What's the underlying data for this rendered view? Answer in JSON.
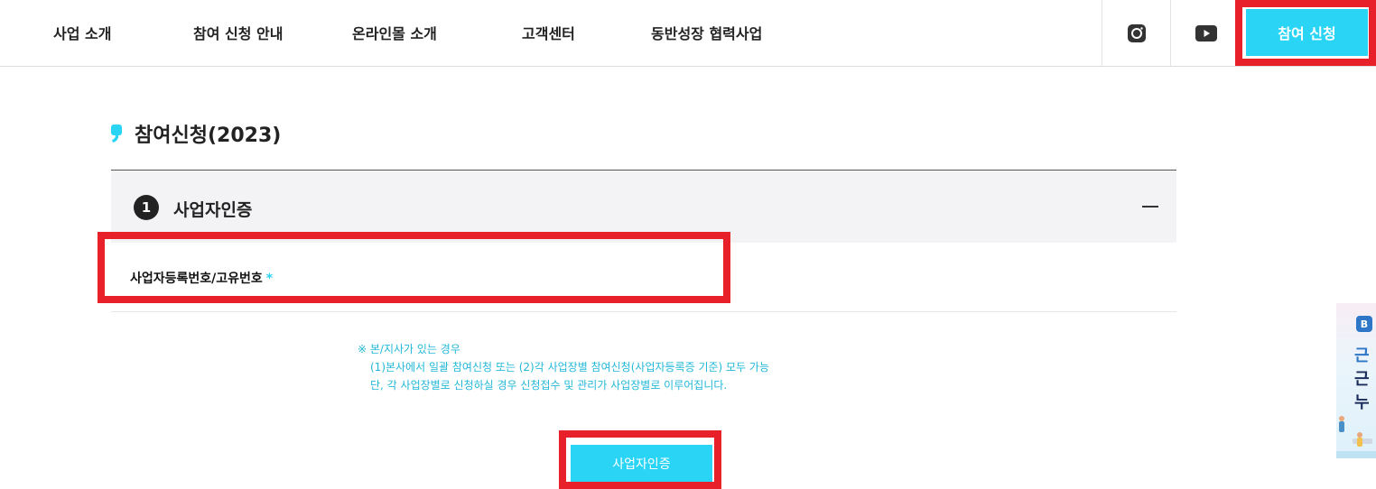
{
  "nav": {
    "items": [
      "사업 소개",
      "참여 신청 안내",
      "온라인몰 소개",
      "고객센터",
      "동반성장 협력사업"
    ],
    "cta_label": "참여 신청"
  },
  "social": {
    "instagram_icon": "instagram-icon",
    "youtube_icon": "youtube-icon"
  },
  "page": {
    "title": "참여신청(2023)"
  },
  "section": {
    "step": "1",
    "title": "사업자인증",
    "field_label": "사업자등록번호/고유번호",
    "required_mark": "*"
  },
  "notes": [
    "※ 본/지사가 있는 경우",
    "(1)본사에서 일괄 참여신청 또는 (2)각 사업장별 참여신청(사업자등록증 기준) 모두 가능",
    "단, 각 사업장별로 신청하실 경우 신청접수 및 관리가 사업장별로 이루어집니다."
  ],
  "submit_label": "사업자인증",
  "banner": {
    "logo": "B",
    "line1": "근",
    "line2": "근",
    "line3": "누"
  },
  "colors": {
    "accent": "#2ad4f5",
    "highlight": "#e8202a",
    "note_text": "#23b8d8"
  }
}
